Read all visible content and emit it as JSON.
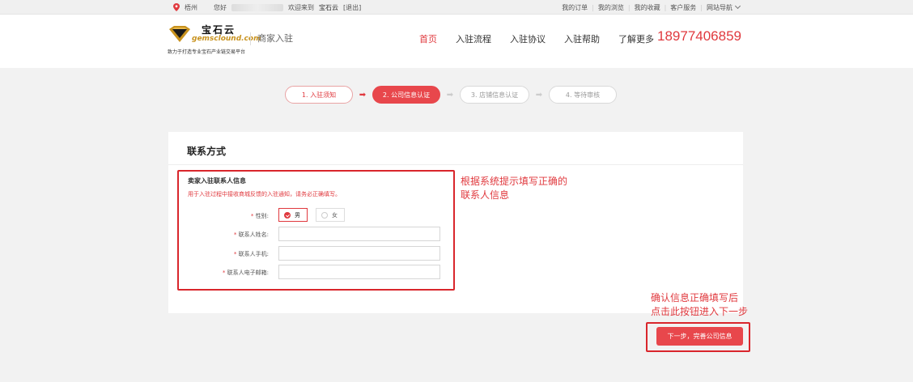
{
  "topbar": {
    "city": "梧州",
    "greeting": "您好",
    "welcome": "欢迎来到",
    "site_name": "宝石云",
    "logout": "[退出]",
    "links": [
      "我的订单",
      "我的浏览",
      "我的收藏",
      "客户服务",
      "网站导航"
    ]
  },
  "header": {
    "logo_cn": "宝石云",
    "logo_en": "gemsclound.com",
    "logo_tagline": "致力于打造专业宝石产业链交易平台",
    "subtitle": "商家入驻",
    "nav": [
      "首页",
      "入驻流程",
      "入驻协议",
      "入驻帮助",
      "了解更多"
    ],
    "active_nav": "首页",
    "phone": "18977406859"
  },
  "steps": [
    "1. 入驻须知",
    "2. 公司信息认证",
    "3. 店铺信息认证",
    "4. 等待审核"
  ],
  "card": {
    "title": "联系方式",
    "section_title": "卖家入驻联系人信息",
    "section_note": "用于入驻过程中接收商城反馈的入驻通知，请务必正确填写。",
    "gender_label": "性别:",
    "gender_options": [
      "男",
      "女"
    ],
    "gender_selected": "男",
    "name_label": "联系人姓名:",
    "name_value": "",
    "phone_label": "联系人手机:",
    "phone_value": "",
    "email_label": "联系人电子邮箱:",
    "email_value": ""
  },
  "annotations": {
    "form_hint_line1": "根据系统提示填写正确的",
    "form_hint_line2": "联系人信息",
    "button_hint_line1": "确认信息正确填写后",
    "button_hint_line2": "点击此按钮进入下一步"
  },
  "next_button": "下一步，完善公司信息",
  "colors": {
    "accent": "#e0393e",
    "annotation_box": "#d9262c"
  }
}
